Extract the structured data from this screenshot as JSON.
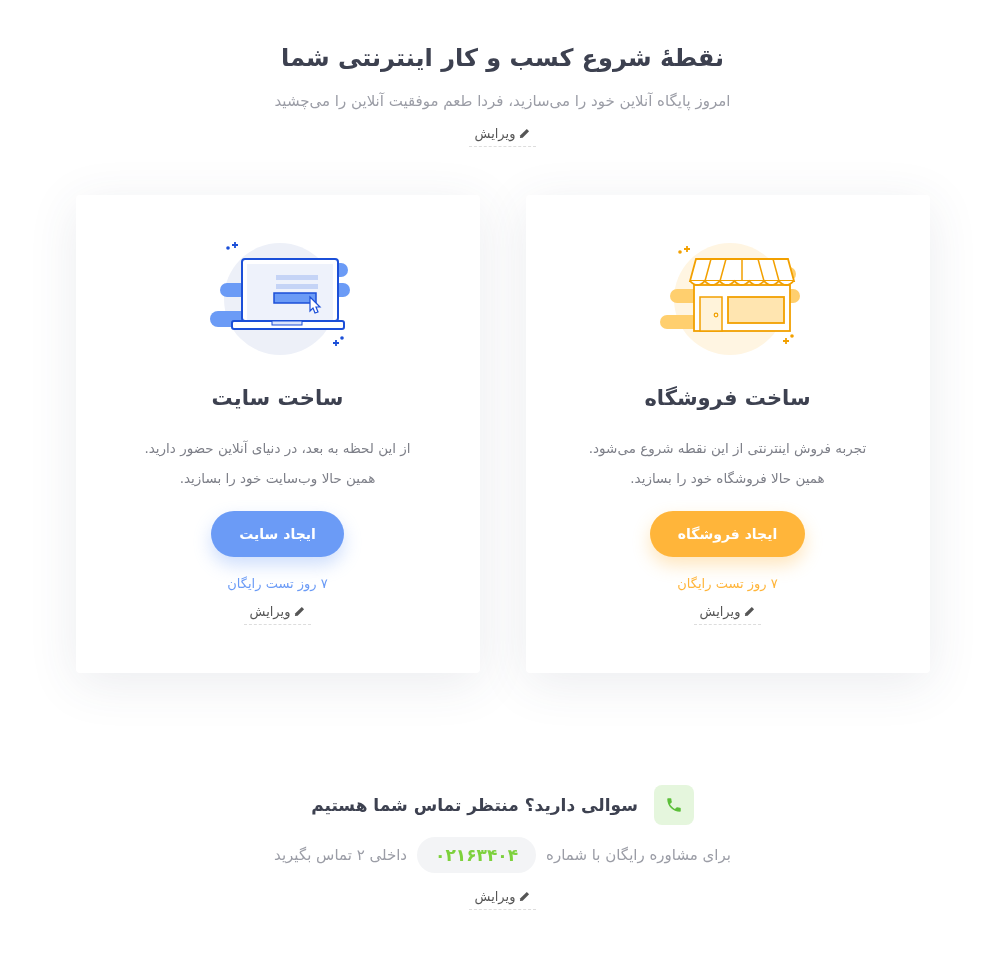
{
  "header": {
    "title": "نقطهٔ شروع کسب و کار اینترنتی شما",
    "subtitle": "امروز پایگاه آنلاین خود را می‌سازید، فردا طعم موفقیت آنلاین را می‌چشید",
    "edit_link": "ویرایش"
  },
  "cards": [
    {
      "kind": "store",
      "color": "#ffb53a",
      "title": "ساخت فروشگاه",
      "description": [
        "تجربه فروش اینترنتی از این نقطه شروع می‌شود.",
        "همین حالا فروشگاه خود را بسازید."
      ],
      "button": "ایجاد فروشگاه",
      "trial": "۷ روز تست رایگان",
      "edit_link": "ویرایش"
    },
    {
      "kind": "site",
      "color": "#6b9bf6",
      "title": "ساخت سایت",
      "description": [
        "از این لحظه به بعد، در دنیای آنلاین حضور دارید.",
        "همین حالا وب‌سایت خود را بسازید."
      ],
      "button": "ایجاد سایت",
      "trial": "۷ روز تست رایگان",
      "edit_link": "ویرایش"
    }
  ],
  "contact": {
    "title": "سوالی دارید؟ منتظر تماس شما هستیم",
    "text_before": "برای مشاوره رایگان با شماره",
    "phone": "۰۲۱۶۳۴۰۴",
    "text_after": "داخلی ۲ تماس بگیرید",
    "edit_link": "ویرایش"
  }
}
